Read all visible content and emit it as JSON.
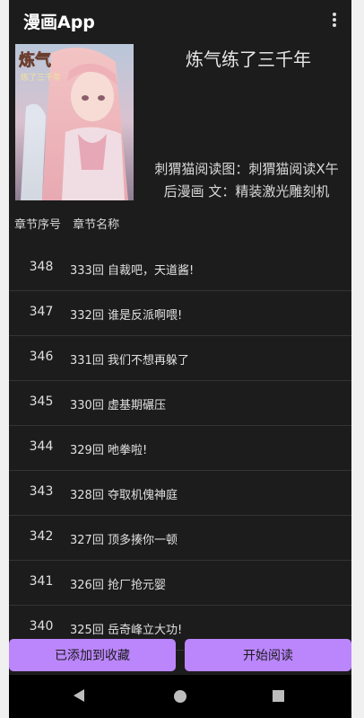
{
  "appbar": {
    "title": "漫画App",
    "menu_icon": "more-vert-icon"
  },
  "book": {
    "title": "炼气练了三千年",
    "meta_line1": "刺猬猫阅读图：刺猬猫阅读X午",
    "meta_line2": "后漫画 文：精装激光雕刻机",
    "cover_text": "炼气练了三千年"
  },
  "list_header": {
    "col_num": "章节序号",
    "col_name": "章节名称"
  },
  "chapters": [
    {
      "num": "348",
      "name": "333回 自裁吧，天道酱!"
    },
    {
      "num": "347",
      "name": "332回 谁是反派啊喂!"
    },
    {
      "num": "346",
      "name": "331回 我们不想再躲了"
    },
    {
      "num": "345",
      "name": "330回 虚基期碾压"
    },
    {
      "num": "344",
      "name": "329回 吔拳啦!"
    },
    {
      "num": "343",
      "name": "328回 夺取机傀神庭"
    },
    {
      "num": "342",
      "name": "327回 顶多揍你一顿"
    },
    {
      "num": "341",
      "name": "326回 抢厂抢元婴"
    },
    {
      "num": "340",
      "name": "325回 岳奇峰立大功!"
    }
  ],
  "buttons": {
    "favorite": "已添加到收藏",
    "read": "开始阅读"
  },
  "colors": {
    "accent": "#bb86fc",
    "background": "#1c1c1c"
  }
}
